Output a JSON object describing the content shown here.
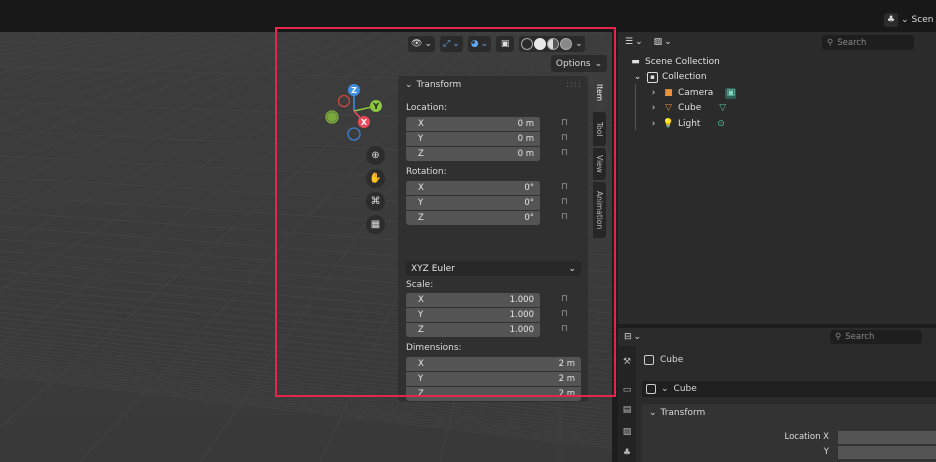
{
  "topbar": {
    "scene_label": "Scen"
  },
  "viewport": {
    "header": {
      "shading": [
        "wireframe",
        "solid",
        "material",
        "rendered"
      ]
    },
    "options_label": "Options",
    "gizmo": {
      "z": "Z",
      "y": "Y",
      "x": "X"
    }
  },
  "npanel": {
    "transform_title": "Transform",
    "location_label": "Location:",
    "location": [
      {
        "axis": "X",
        "value": "0 m"
      },
      {
        "axis": "Y",
        "value": "0 m"
      },
      {
        "axis": "Z",
        "value": "0 m"
      }
    ],
    "rotation_label": "Rotation:",
    "rotation": [
      {
        "axis": "X",
        "value": "0°"
      },
      {
        "axis": "Y",
        "value": "0°"
      },
      {
        "axis": "Z",
        "value": "0°"
      }
    ],
    "rotation_mode": "XYZ Euler",
    "scale_label": "Scale:",
    "scale": [
      {
        "axis": "X",
        "value": "1.000"
      },
      {
        "axis": "Y",
        "value": "1.000"
      },
      {
        "axis": "Z",
        "value": "1.000"
      }
    ],
    "dimensions_label": "Dimensions:",
    "dimensions": [
      {
        "axis": "X",
        "value": "2 m"
      },
      {
        "axis": "Y",
        "value": "2 m"
      },
      {
        "axis": "Z",
        "value": "2 m"
      }
    ],
    "tabs": [
      "Item",
      "Tool",
      "View",
      "Animation"
    ]
  },
  "outliner": {
    "search_placeholder": "Search",
    "scene_collection": "Scene Collection",
    "collection": "Collection",
    "items": [
      "Camera",
      "Cube",
      "Light"
    ]
  },
  "properties": {
    "search_placeholder": "Search",
    "context_name": "Cube",
    "object_name": "Cube",
    "panel_title": "Transform",
    "location_x_label": "Location X",
    "y_label": "Y"
  },
  "colors": {
    "highlight": "#e4264e",
    "axis_x": "#f04a5a",
    "axis_y": "#8cc63f",
    "axis_z": "#3f8fe0"
  }
}
